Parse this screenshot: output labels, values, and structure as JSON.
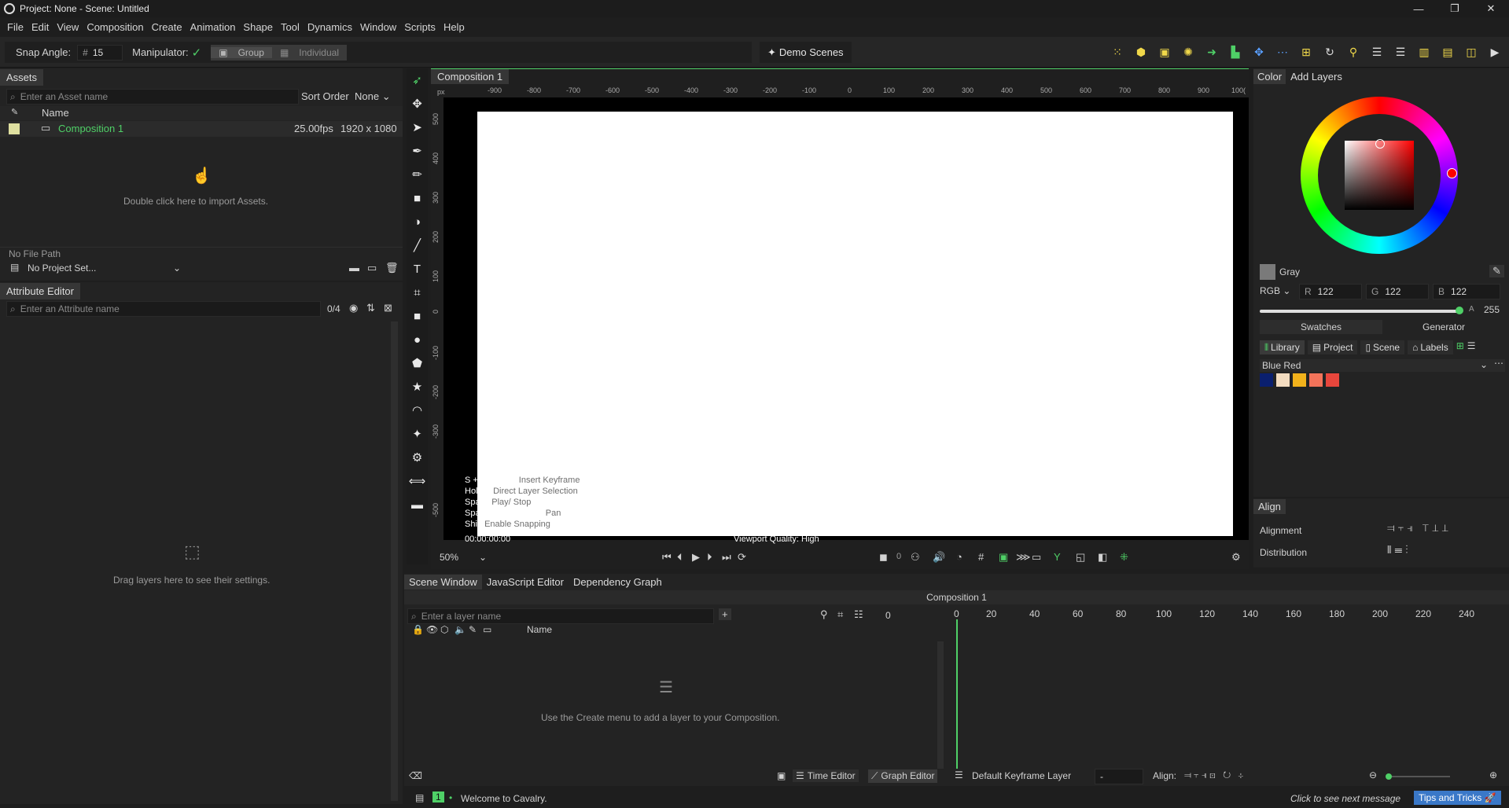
{
  "window": {
    "title": "Project: None - Scene: Untitled",
    "controls": [
      "—",
      "❐",
      "✕"
    ]
  },
  "menu": [
    "File",
    "Edit",
    "View",
    "Composition",
    "Create",
    "Animation",
    "Shape",
    "Tool",
    "Dynamics",
    "Window",
    "Scripts",
    "Help"
  ],
  "toolbar": {
    "snap_label": "Snap Angle:",
    "snap_hash": "#",
    "snap_value": "15",
    "manipulator_label": "Manipulator:",
    "group_label": "Group",
    "individual_label": "Individual",
    "demo_scenes": "Demo Scenes"
  },
  "assets": {
    "tab": "Assets",
    "search_placeholder": "Enter an Asset name",
    "sort_label": "Sort Order",
    "sort_value": "None",
    "col_name": "Name",
    "item_name": "Composition 1",
    "item_fps": "25.00fps",
    "item_res": "1920 x 1080",
    "import_hint": "Double click here to import Assets.",
    "file_path": "No File Path",
    "project": "No Project Set...",
    "accent": "#4fd067"
  },
  "attr": {
    "tab": "Attribute Editor",
    "search_placeholder": "Enter an Attribute name",
    "count": "0/4",
    "empty_hint": "Drag layers here to see their settings."
  },
  "viewport": {
    "tab": "Composition 1",
    "unit": "px",
    "hruler": [
      "-900",
      "-800",
      "-700",
      "-600",
      "-500",
      "-400",
      "-300",
      "-200",
      "-100",
      "0",
      "100",
      "200",
      "300",
      "400",
      "500",
      "600",
      "700",
      "800",
      "900",
      "100("
    ],
    "vruler": [
      "500",
      "400",
      "300",
      "200",
      "100",
      "0",
      "-100",
      "-200",
      "-300",
      "-500"
    ],
    "hints": [
      {
        "k": "S + click path",
        "v": "Insert Keyframe"
      },
      {
        "k": "Hold S",
        "v": "Direct Layer Selection"
      },
      {
        "k": "Space",
        "v": "Play/ Stop"
      },
      {
        "k": "Space + click + drag",
        "v": "Pan"
      },
      {
        "k": "Shift",
        "v": "Enable Snapping"
      }
    ],
    "timecode": "00:00:00:00",
    "quality": "Viewport Quality: High",
    "zoom": "50%",
    "frame_field": "0"
  },
  "color": {
    "tab_color": "Color",
    "tab_layers": "Add Layers",
    "name": "Gray",
    "mode": "RGB",
    "r_label": "R",
    "r": "122",
    "g_label": "G",
    "g": "122",
    "b_label": "B",
    "b": "122",
    "a_label": "A",
    "a": "255",
    "tab_swatches": "Swatches",
    "tab_generator": "Generator",
    "lib": "Library",
    "project": "Project",
    "scene": "Scene",
    "labels": "Labels",
    "palette": "Blue Red",
    "swatches": [
      "#0a1f6e",
      "#f3dcc0",
      "#f2b21b",
      "#f3735a",
      "#e8463c"
    ],
    "current": "#7a7a7a"
  },
  "align": {
    "tab": "Align",
    "alignment": "Alignment",
    "distribution": "Distribution"
  },
  "scene": {
    "tabs": [
      "Scene Window",
      "JavaScript Editor",
      "Dependency Graph"
    ],
    "comp_title": "Composition 1",
    "search_placeholder": "Enter a layer name",
    "frame": "0",
    "col_name": "Name",
    "empty_hint": "Use the Create menu to add a layer to your Composition.",
    "ticks": [
      "0",
      "20",
      "40",
      "60",
      "80",
      "100",
      "120",
      "140",
      "160",
      "180",
      "200",
      "220",
      "240"
    ],
    "time_editor": "Time Editor",
    "graph_editor": "Graph Editor",
    "keyframe_layer": "Default Keyframe Layer",
    "kf_field": "-",
    "align_label": "Align:"
  },
  "status": {
    "count": "1",
    "message": "Welcome to Cavalry.",
    "next": "Click to see next message",
    "tips": "Tips and Tricks"
  }
}
